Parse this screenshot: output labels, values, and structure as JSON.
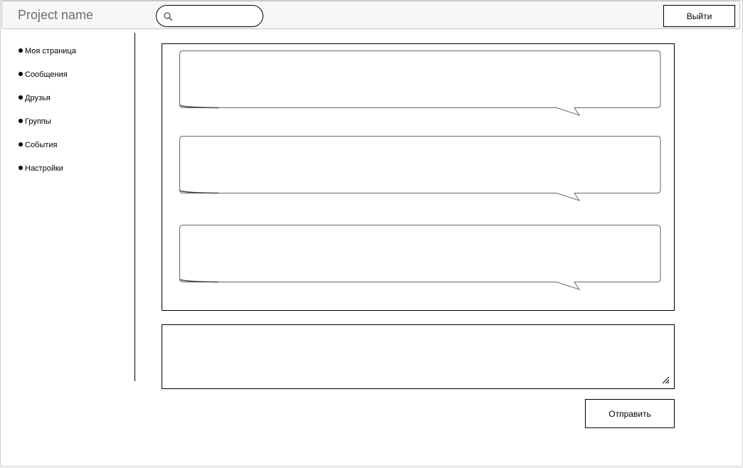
{
  "header": {
    "brand": "Project name",
    "search": {
      "value": "",
      "placeholder": ""
    },
    "logout_label": "Выйти"
  },
  "sidebar": {
    "items": [
      {
        "label": "Моя страница"
      },
      {
        "label": "Сообщения"
      },
      {
        "label": "Друзья"
      },
      {
        "label": "Группы"
      },
      {
        "label": "События"
      },
      {
        "label": "Настройки"
      }
    ]
  },
  "messages": {
    "items": [
      {
        "text": ""
      },
      {
        "text": ""
      },
      {
        "text": ""
      }
    ]
  },
  "compose": {
    "value": "",
    "placeholder": "",
    "send_label": "Отправить"
  },
  "colors": {
    "header_bg": "#f7f7f7",
    "header_border": "#bdc3c7",
    "brand_text": "#6e6e6e",
    "line": "#000000"
  },
  "icons": {
    "search": "search-icon",
    "bullet": "bullet-icon",
    "resize": "resize-handle-icon"
  }
}
